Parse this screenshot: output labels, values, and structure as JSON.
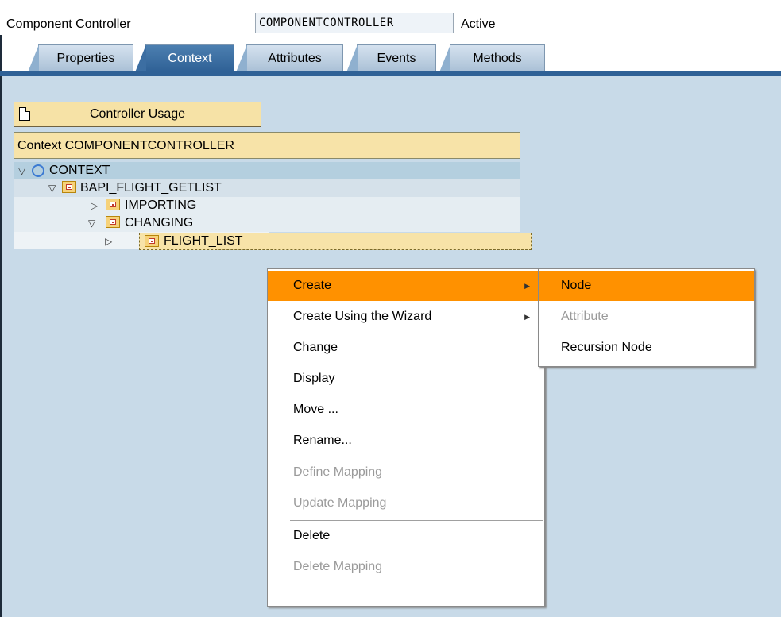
{
  "header": {
    "label": "Component Controller",
    "name_value": "COMPONENTCONTROLLER",
    "status": "Active"
  },
  "tabs": [
    {
      "label": "Properties",
      "active": false
    },
    {
      "label": "Context",
      "active": true
    },
    {
      "label": "Attributes",
      "active": false
    },
    {
      "label": "Events",
      "active": false
    },
    {
      "label": "Methods",
      "active": false
    }
  ],
  "controller_usage_button": {
    "label": "Controller Usage",
    "icon": "document-icon"
  },
  "tree": {
    "title": "Context COMPONENTCONTROLLER",
    "nodes": [
      {
        "label": "CONTEXT",
        "expanded": true,
        "icon": "circle-icon"
      },
      {
        "label": "BAPI_FLIGHT_GETLIST",
        "expanded": true,
        "icon": "folder-icon"
      },
      {
        "label": "IMPORTING",
        "expanded": false,
        "icon": "folder-icon"
      },
      {
        "label": "CHANGING",
        "expanded": true,
        "icon": "folder-icon"
      },
      {
        "label": "FLIGHT_LIST",
        "expanded": false,
        "icon": "folder-icon",
        "selected": true
      }
    ]
  },
  "context_menu": {
    "items": [
      {
        "label": "Create",
        "highlighted": true,
        "submenu": true
      },
      {
        "label": "Create Using the Wizard",
        "submenu": true
      },
      {
        "label": "Change"
      },
      {
        "label": "Display"
      },
      {
        "label": "Move ..."
      },
      {
        "label": "Rename..."
      },
      {
        "label": "Define Mapping",
        "disabled": true
      },
      {
        "label": "Update Mapping",
        "disabled": true
      },
      {
        "label": "Delete"
      },
      {
        "label": "Delete Mapping",
        "disabled": true
      }
    ],
    "submenu_arrow": "▶"
  },
  "submenu": {
    "items": [
      {
        "label": "Node",
        "highlighted": true
      },
      {
        "label": "Attribute",
        "disabled": true
      },
      {
        "label": "Recursion Node"
      }
    ]
  },
  "colors": {
    "highlight": "#ff9100",
    "panel_bg": "#c8dae8",
    "header_yellow": "#f7e3a8",
    "active_tab": "#2f6196"
  }
}
